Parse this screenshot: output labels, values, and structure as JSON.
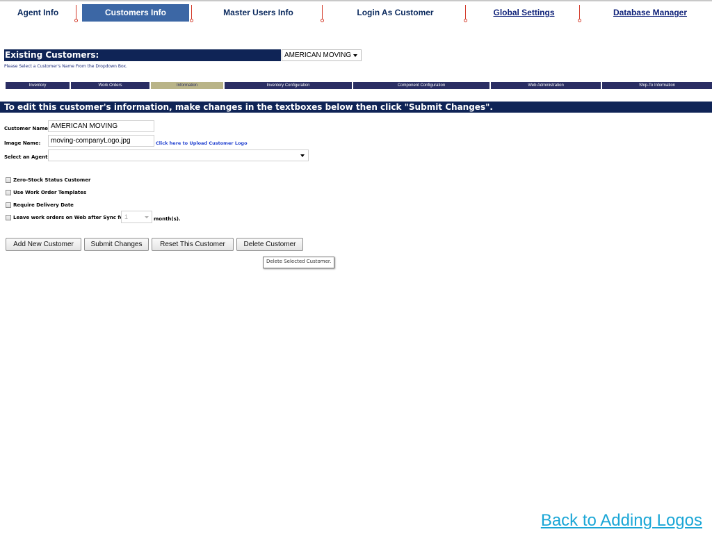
{
  "nav": {
    "items": [
      {
        "label": "Agent Info"
      },
      {
        "label": "Customers Info"
      },
      {
        "label": "Master Users Info"
      },
      {
        "label": "Login As Customer"
      },
      {
        "label": "Global Settings"
      },
      {
        "label": "Database Manager"
      }
    ],
    "active_color": "#3c67a5"
  },
  "existing": {
    "title": "Existing Customers:",
    "selected_customer": "AMERICAN MOVING",
    "hint": "Please Select a Customer's Name From the Dropdown Box."
  },
  "tabs": [
    {
      "label": "Inventory"
    },
    {
      "label": "Work Orders"
    },
    {
      "label": "Information"
    },
    {
      "label": "Inventory Configuration"
    },
    {
      "label": "Component Configuration"
    },
    {
      "label": "Web Administration"
    },
    {
      "label": "Ship-To Information"
    }
  ],
  "instruction": "To edit this customer's information, make changes in the textboxes below then click \"Submit Changes\".",
  "form": {
    "customer_name_label": "Customer Name:",
    "customer_name_value": "AMERICAN MOVING",
    "image_name_label": "Image Name:",
    "image_name_value": "moving-companyLogo.jpg",
    "upload_link": "Click here to Upload Customer Logo",
    "agent_label": "Select an Agent:",
    "agent_value": "",
    "checkboxes": [
      {
        "label": "Zero-Stock Status Customer"
      },
      {
        "label": "Use Work Order Templates"
      },
      {
        "label": "Require Delivery Date"
      },
      {
        "label": "Leave work orders on Web after Sync for"
      }
    ],
    "months_value": "1",
    "months_suffix": "month(s)."
  },
  "buttons": {
    "add": "Add New Customer",
    "submit": "Submit Changes",
    "reset": "Reset This Customer",
    "delete": "Delete Customer"
  },
  "tooltip": "Delete Selected Customer.",
  "back_link": "Back to Adding Logos",
  "colors": {
    "navy": "#0f2456",
    "tab_bg": "#2a2e63",
    "tab_active": "#b9b488",
    "link_blue": "#1aa6d6"
  }
}
